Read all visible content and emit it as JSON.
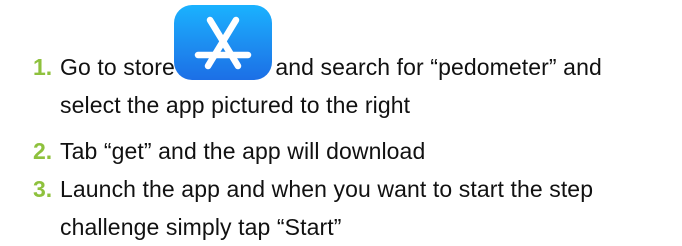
{
  "steps": [
    {
      "number": "1.",
      "lines": [
        {
          "before": "Go to store",
          "after": "and search for “pedometer” and"
        },
        {
          "text": "select the app pictured to the right"
        }
      ],
      "icon": "app-store-icon"
    },
    {
      "number": "2.",
      "lines": [
        {
          "text": "Tab “get” and the app will download"
        }
      ]
    },
    {
      "number": "3.",
      "lines": [
        {
          "text": "Launch the app and when you want to start the step"
        },
        {
          "text": "challenge simply tap “Start”"
        }
      ]
    }
  ],
  "colors": {
    "number": "#8ec13d",
    "text": "#111111",
    "icon_gradient_top": "#1ab2ff",
    "icon_gradient_bottom": "#1c6fe6"
  }
}
